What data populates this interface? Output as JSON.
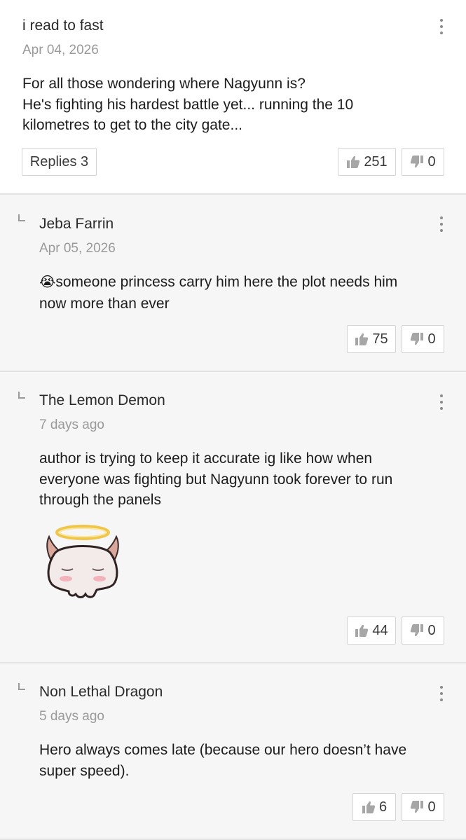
{
  "comments": [
    {
      "author": "i read to fast",
      "date": "Apr 04, 2026",
      "lines": [
        "For all those wondering where Nagyunn is?",
        "He's fighting his hardest battle yet... running the 10",
        "kilometres to get to the city gate..."
      ],
      "replies_label": "Replies 3",
      "likes": "251",
      "dislikes": "0"
    },
    {
      "author": "Jeba Farrin",
      "date": "Apr 05, 2026",
      "emoji": "😭",
      "lines": [
        "someone princess carry him here the plot needs him",
        "now more than ever"
      ],
      "likes": "75",
      "dislikes": "0"
    },
    {
      "author": "The Lemon Demon",
      "date": "7 days ago",
      "lines": [
        "author is trying to keep it accurate ig like how when",
        "everyone was fighting but Nagyunn took forever to run",
        "through the panels"
      ],
      "sticker": "horned-skull-with-halo-sticker",
      "likes": "44",
      "dislikes": "0"
    },
    {
      "author": "Non Lethal Dragon",
      "date": "5 days ago",
      "lines": [
        "Hero always comes late (because our hero doesn’t have",
        "super speed)."
      ],
      "likes": "6",
      "dislikes": "0"
    }
  ],
  "icons": {
    "like": "thumbs-up-icon",
    "dislike": "thumbs-down-icon",
    "more": "more-vertical-icon",
    "reply": "reply-corner-icon"
  },
  "colors": {
    "background": "#ffffff",
    "reply_background": "#f6f6f6",
    "icon_gray": "#9a9a9a",
    "text": "#1c1c1c"
  }
}
